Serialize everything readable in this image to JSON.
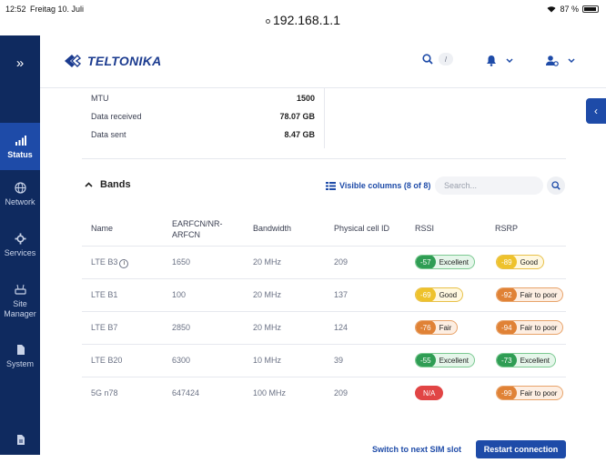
{
  "ios": {
    "time": "12:52",
    "date": "Freitag 10. Juli",
    "battery": "87 %"
  },
  "browser": {
    "url": "192.168.1.1"
  },
  "sidebar": {
    "items": [
      {
        "label": "Status",
        "icon": "bar-chart-icon"
      },
      {
        "label": "Network",
        "icon": "globe-icon"
      },
      {
        "label": "Services",
        "icon": "gear-icon"
      },
      {
        "label": "Site Manager",
        "icon": "router-icon"
      },
      {
        "label": "System",
        "icon": "file-icon"
      }
    ]
  },
  "header": {
    "brand": "TELTONIKA",
    "search_shortcut": "/"
  },
  "details": [
    {
      "key": "MTU",
      "value": "1500"
    },
    {
      "key": "Data received",
      "value": "78.07 GB"
    },
    {
      "key": "Data sent",
      "value": "8.47 GB"
    }
  ],
  "bands": {
    "title": "Bands",
    "visible_columns": "Visible columns (8 of 8)",
    "search_placeholder": "Search...",
    "columns": [
      "Name",
      "EARFCN/NR-ARFCN",
      "Bandwidth",
      "Physical cell ID",
      "RSSI",
      "RSRP"
    ],
    "rows": [
      {
        "name": "LTE B3",
        "earfcn": "1650",
        "bandwidth": "20 MHz",
        "pci": "209",
        "rssi": "-57",
        "rssi_label": "Excellent",
        "rsrp": "-89",
        "rsrp_label": "Good"
      },
      {
        "name": "LTE B1",
        "earfcn": "100",
        "bandwidth": "20 MHz",
        "pci": "137",
        "rssi": "-69",
        "rssi_label": "Good",
        "rsrp": "-92",
        "rsrp_label": "Fair to poor"
      },
      {
        "name": "LTE B7",
        "earfcn": "2850",
        "bandwidth": "20 MHz",
        "pci": "124",
        "rssi": "-76",
        "rssi_label": "Fair",
        "rsrp": "-94",
        "rsrp_label": "Fair to poor"
      },
      {
        "name": "LTE B20",
        "earfcn": "6300",
        "bandwidth": "10 MHz",
        "pci": "39",
        "rssi": "-55",
        "rssi_label": "Excellent",
        "rsrp": "-73",
        "rsrp_label": "Excellent"
      },
      {
        "name": "5G n78",
        "earfcn": "647424",
        "bandwidth": "100 MHz",
        "pci": "209",
        "rssi": "N/A",
        "rssi_label": "",
        "rsrp": "-99",
        "rsrp_label": "Fair to poor"
      }
    ]
  },
  "footer": {
    "switch_sim": "Switch to next SIM slot",
    "restart": "Restart connection"
  },
  "colors": {
    "sidebar": "#0f2a5f",
    "accent": "#1e4ba8",
    "excellent": "#2f9d54",
    "good": "#eec22c",
    "fair": "#e08236",
    "na": "#e14545"
  }
}
